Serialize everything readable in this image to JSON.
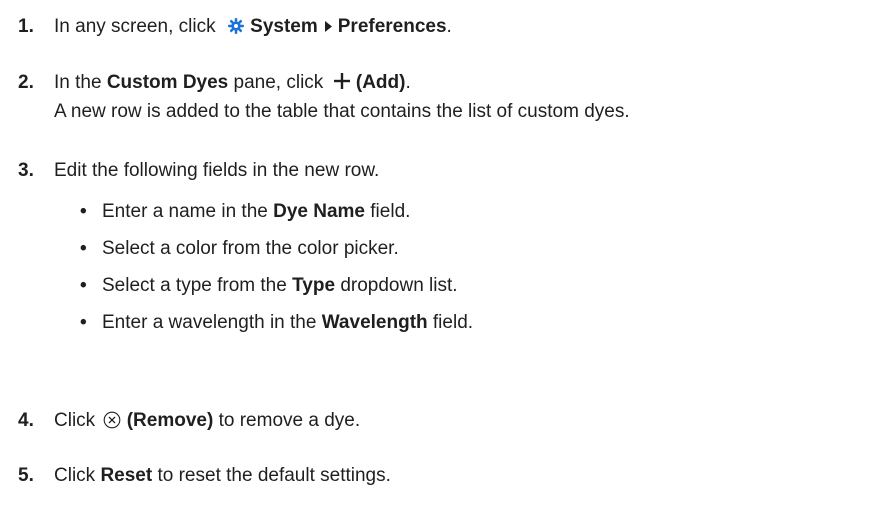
{
  "steps": [
    {
      "number": "1.",
      "parts": {
        "before": "In any screen, click",
        "system": "System",
        "preferences": "Preferences",
        "after": "."
      }
    },
    {
      "number": "2.",
      "parts": {
        "in_the": "In the",
        "pane_name": "Custom Dyes",
        "pane_click": "pane, click",
        "add_label": "(Add)",
        "after": "."
      },
      "result": "A new row is added to the table that contains the list of custom dyes."
    },
    {
      "number": "3.",
      "text": "Edit the following fields in the new row.",
      "bullets": [
        {
          "before": "Enter a name in the",
          "bold": "Dye Name",
          "after": "field."
        },
        {
          "before": "Select a color from the color picker.",
          "bold": "",
          "after": ""
        },
        {
          "before": "Select a type from the",
          "bold": "Type",
          "after": "dropdown list."
        },
        {
          "before": "Enter a wavelength in the",
          "bold": "Wavelength",
          "after": "field."
        }
      ]
    },
    {
      "number": "4.",
      "parts": {
        "click": "Click",
        "remove_label": "(Remove)",
        "after": "to remove a dye."
      }
    },
    {
      "number": "5.",
      "parts": {
        "click": "Click",
        "reset_label": "Reset",
        "after": "to reset the default settings."
      }
    }
  ],
  "colors": {
    "gear": "#1a73d9",
    "text": "#1f1f1f"
  }
}
